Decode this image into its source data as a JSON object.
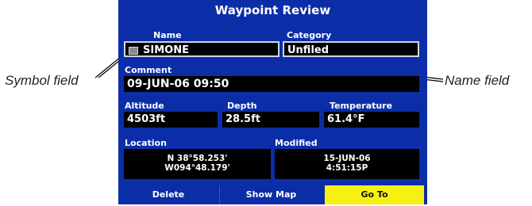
{
  "title": "Waypoint Review",
  "name": {
    "label": "Name",
    "value": "SIMONE"
  },
  "category": {
    "label": "Category",
    "value": "Unfiled"
  },
  "comment": {
    "label": "Comment",
    "value": "09-JUN-06 09:50"
  },
  "altitude": {
    "label": "Altitude",
    "value": "4503ft"
  },
  "depth": {
    "label": "Depth",
    "value": "28.5ft"
  },
  "temperature": {
    "label": "Temperature",
    "value": "61.4°F"
  },
  "location": {
    "label": "Location",
    "lat": "N  38°58.253'",
    "lon": "W094°48.179'"
  },
  "modified": {
    "label": "Modified",
    "date": "15-JUN-06",
    "time": "4:51:15P"
  },
  "buttons": {
    "delete": "Delete",
    "show_map": "Show Map",
    "go_to": "Go To"
  },
  "callouts": {
    "symbol_field": "Symbol field",
    "name_field": "Name field"
  },
  "colors": {
    "screen_bg": "#0b2ea8",
    "field_bg": "#000000",
    "highlight": "#f7f112"
  }
}
